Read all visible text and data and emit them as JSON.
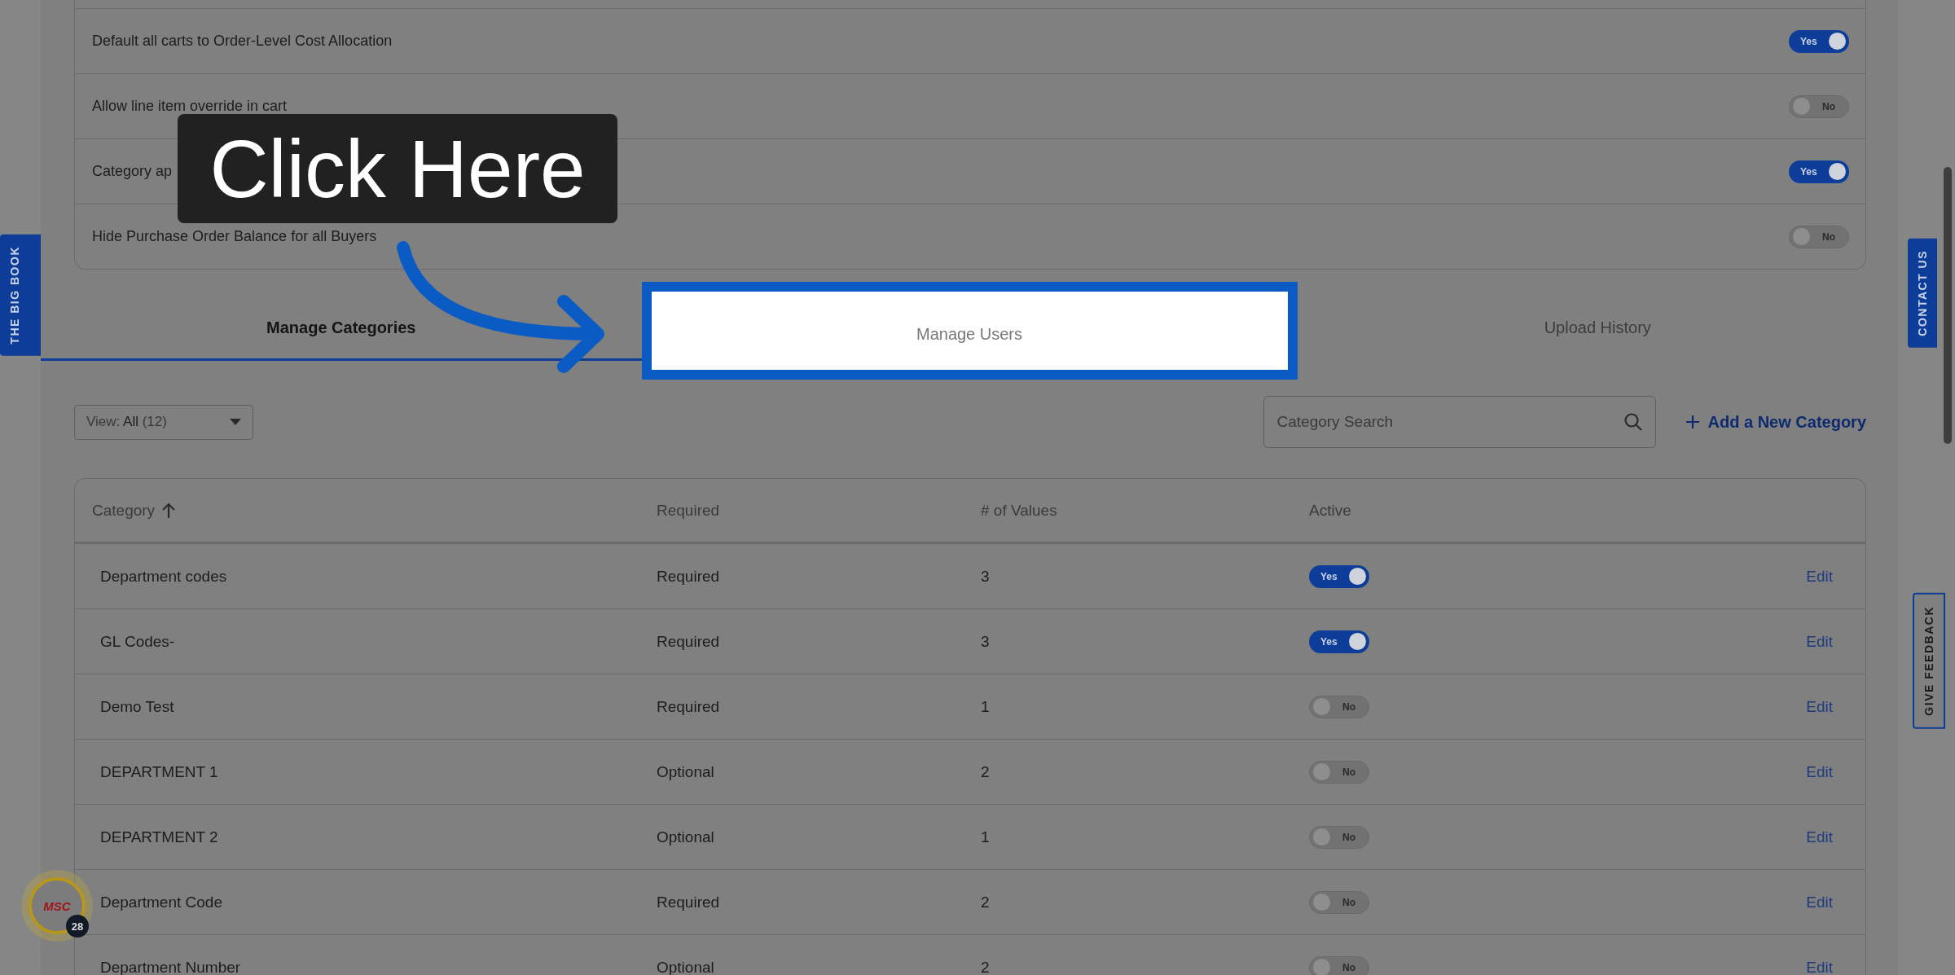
{
  "side_tabs": {
    "left": "THE BIG BOOK",
    "contact": "CONTACT US",
    "feedback": "GIVE FEEDBACK"
  },
  "settings": [
    {
      "label": "Default all carts to Order-Level Cost Allocation",
      "on": true,
      "toggle_label": "Yes"
    },
    {
      "label": "Allow line item override in cart",
      "on": false,
      "toggle_label": "No"
    },
    {
      "label": "Category ap",
      "on": true,
      "toggle_label": "Yes"
    },
    {
      "label": "Hide Purchase Order Balance for all Buyers",
      "on": false,
      "toggle_label": "No"
    }
  ],
  "callout": {
    "text": "Click Here"
  },
  "tabs": [
    {
      "label": "Manage Categories",
      "selected": true,
      "highlight": false
    },
    {
      "label": "Manage Users",
      "selected": false,
      "highlight": true
    },
    {
      "label": "Upload History",
      "selected": false,
      "highlight": false
    }
  ],
  "view_filter": {
    "prefix": "View:",
    "value": "All",
    "count": "(12)"
  },
  "search": {
    "placeholder": "Category Search"
  },
  "add_button": {
    "label": "Add a New Category"
  },
  "table": {
    "columns": [
      "Category",
      "Required",
      "# of Values",
      "Active"
    ],
    "rows": [
      {
        "category": "Department codes",
        "required": "Required",
        "values": "3",
        "active": true,
        "toggle_label": "Yes",
        "action": "Edit"
      },
      {
        "category": "GL Codes-",
        "required": "Required",
        "values": "3",
        "active": true,
        "toggle_label": "Yes",
        "action": "Edit"
      },
      {
        "category": "Demo Test",
        "required": "Required",
        "values": "1",
        "active": false,
        "toggle_label": "No",
        "action": "Edit"
      },
      {
        "category": "DEPARTMENT 1",
        "required": "Optional",
        "values": "2",
        "active": false,
        "toggle_label": "No",
        "action": "Edit"
      },
      {
        "category": "DEPARTMENT 2",
        "required": "Optional",
        "values": "1",
        "active": false,
        "toggle_label": "No",
        "action": "Edit"
      },
      {
        "category": "Department Code",
        "required": "Required",
        "values": "2",
        "active": false,
        "toggle_label": "No",
        "action": "Edit"
      },
      {
        "category": "Department Number",
        "required": "Optional",
        "values": "2",
        "active": false,
        "toggle_label": "No",
        "action": "Edit"
      }
    ]
  },
  "widget": {
    "logo_text": "MSC",
    "count": "28"
  }
}
